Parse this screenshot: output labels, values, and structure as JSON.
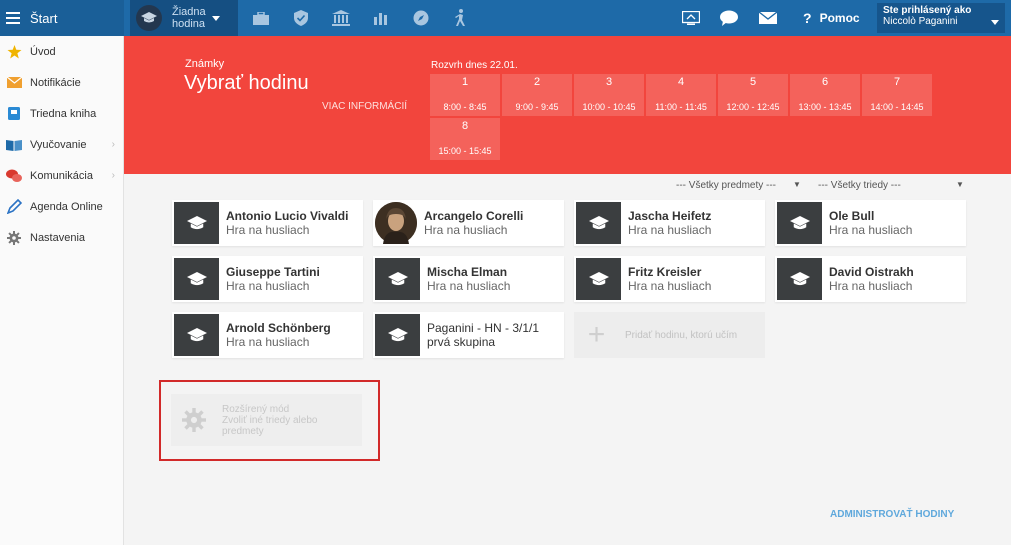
{
  "topbar": {
    "brand": "Štart",
    "lesson_picker": {
      "line1": "Žiadna",
      "line2": "hodina"
    },
    "icons": [
      "briefcase-icon",
      "shield-check-icon",
      "bank-icon",
      "bar-chart-icon",
      "compass-icon",
      "hiking-icon"
    ],
    "right_icons": [
      "screen-share-icon",
      "chat-icon",
      "mail-icon"
    ],
    "help_label": "Pomoc",
    "user": {
      "label": "Ste prihlásený ako",
      "name": "Niccolò Paganini"
    }
  },
  "sidebar": {
    "items": [
      {
        "label": "Úvod",
        "icon": "star-icon",
        "color": "#f0b400",
        "chevron": false
      },
      {
        "label": "Notifikácie",
        "icon": "envelope-icon",
        "color": "#f0a030",
        "chevron": false
      },
      {
        "label": "Triedna kniha",
        "icon": "book-square-icon",
        "color": "#2a8ad4",
        "chevron": false
      },
      {
        "label": "Vyučovanie",
        "icon": "open-book-icon",
        "color": "#1e6aa8",
        "chevron": true
      },
      {
        "label": "Komunikácia",
        "icon": "chat-bubbles-icon",
        "color": "#d93a2f",
        "chevron": true
      },
      {
        "label": "Agenda Online",
        "icon": "pen-icon",
        "color": "#2a72c4",
        "chevron": false
      },
      {
        "label": "Nastavenia",
        "icon": "gear-icon",
        "color": "#777777",
        "chevron": false
      }
    ]
  },
  "hero": {
    "subtitle": "Známky",
    "title": "Vybrať hodinu",
    "more": "VIAC INFORMÁCIÍ",
    "schedule_label": "Rozvrh dnes 22.01.",
    "slots": [
      {
        "num": "1",
        "time": "8:00 - 8:45"
      },
      {
        "num": "2",
        "time": "9:00 - 9:45"
      },
      {
        "num": "3",
        "time": "10:00 - 10:45"
      },
      {
        "num": "4",
        "time": "11:00 - 11:45"
      },
      {
        "num": "5",
        "time": "12:00 - 12:45"
      },
      {
        "num": "6",
        "time": "13:00 - 13:45"
      },
      {
        "num": "7",
        "time": "14:00 - 14:45"
      },
      {
        "num": "8",
        "time": "15:00 - 15:45"
      }
    ]
  },
  "filters": {
    "subjects": "--- Všetky predmety ---",
    "classes": "--- Všetky triedy ---"
  },
  "cards": [
    {
      "name": "Antonio Lucio Vivaldi",
      "subject": "Hra na husliach"
    },
    {
      "name": "Arcangelo Corelli",
      "subject": "Hra na husliach"
    },
    {
      "name": "Jascha Heifetz",
      "subject": "Hra na husliach"
    },
    {
      "name": "Ole Bull",
      "subject": "Hra na husliach"
    },
    {
      "name": "Giuseppe Tartini",
      "subject": "Hra na husliach"
    },
    {
      "name": "Mischa Elman",
      "subject": "Hra na husliach"
    },
    {
      "name": "Fritz Kreisler",
      "subject": "Hra na husliach"
    },
    {
      "name": "David Oistrakh",
      "subject": "Hra na husliach"
    },
    {
      "name": "Arnold Schönberg",
      "subject": "Hra na husliach"
    },
    {
      "name": "Paganini - HN - 3/1/1",
      "subject": "prvá skupina"
    }
  ],
  "add_lesson": "Pridať hodinu, ktorú učím",
  "advanced": {
    "line1": "Rozšírený mód",
    "line2": "Zvoliť iné triedy alebo",
    "line3": "predmety"
  },
  "admin_link": "ADMINISTROVAŤ HODINY"
}
